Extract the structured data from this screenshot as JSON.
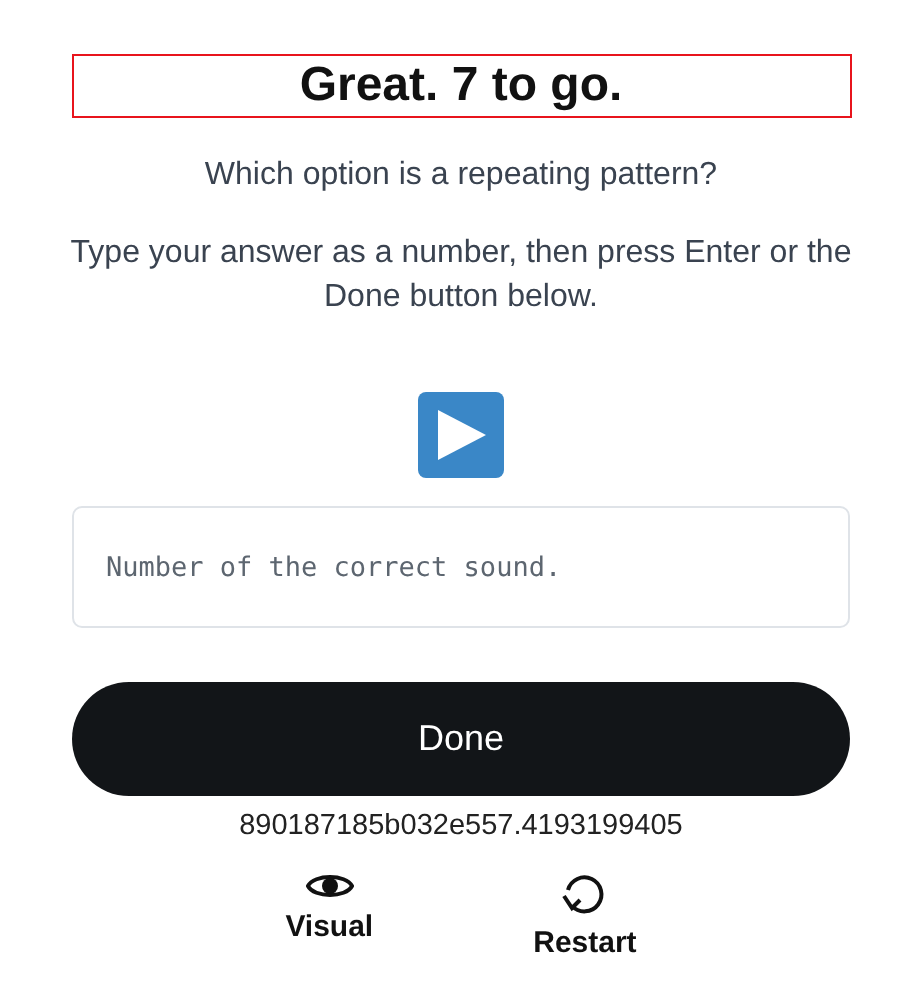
{
  "heading": "Great. 7 to go.",
  "question": "Which option is a repeating pattern?",
  "instructions": "Type your answer as a number, then press Enter or the Done button below.",
  "answer": {
    "placeholder": "Number of the correct sound."
  },
  "done_button": "Done",
  "session_id": "890187185b032e557.4193199405",
  "actions": [
    {
      "kind": "visual",
      "label": "Visual"
    },
    {
      "kind": "restart",
      "label": "Restart"
    }
  ]
}
